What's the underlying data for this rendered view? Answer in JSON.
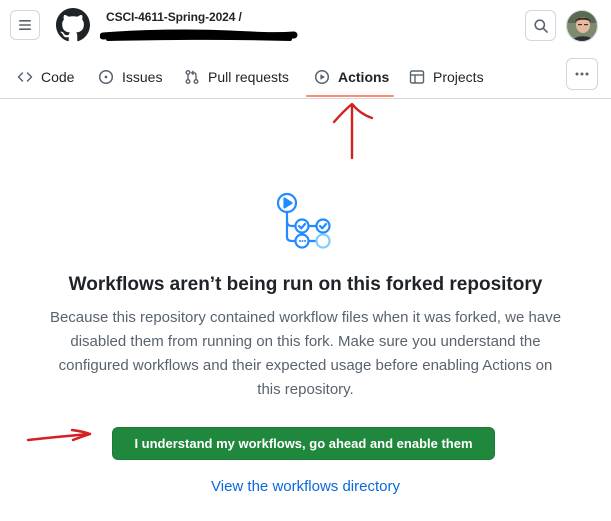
{
  "header": {
    "repo_owner": "CSCI-4611-Spring-2024 /"
  },
  "tabs": [
    {
      "label": "Code",
      "icon": "code-icon"
    },
    {
      "label": "Issues",
      "icon": "issue-opened-icon"
    },
    {
      "label": "Pull requests",
      "icon": "git-pull-request-icon"
    },
    {
      "label": "Actions",
      "icon": "play-icon",
      "active": true
    },
    {
      "label": "Projects",
      "icon": "table-icon"
    }
  ],
  "blankslate": {
    "title": "Workflows aren’t being run on this forked repository",
    "description": "Because this repository contained workflow files when it was forked, we have disabled them from running on this fork. Make sure you understand the configured workflows and their expected usage before enabling Actions on this repository.",
    "enable_button": "I understand my workflows, go ahead and enable them",
    "view_link": "View the workflows directory"
  },
  "colors": {
    "primary_button": "#1f883d",
    "link": "#0969da",
    "tab_underline": "#fd8c73",
    "annotation": "#d42020"
  }
}
